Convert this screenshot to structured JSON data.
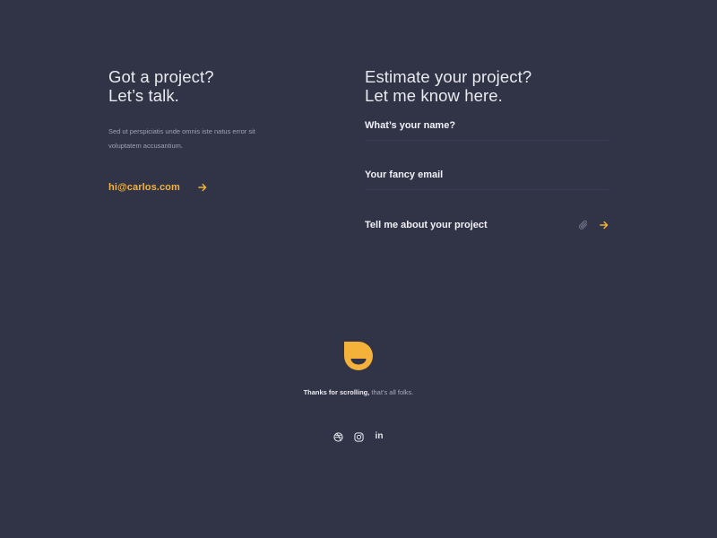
{
  "contact": {
    "heading_line1": "Got a project?",
    "heading_line2": "Let’s talk.",
    "lead": "Sed ut perspiciatis unde omnis iste natus error sit voluptatem accusantium.",
    "email": "hi@carlos.com"
  },
  "form": {
    "title_line1": "Estimate your project?",
    "title_line2": "Let me know here.",
    "name_placeholder": "What’s your name?",
    "email_placeholder": "Your fancy email",
    "project_placeholder": "Tell me about your project"
  },
  "footer": {
    "thanks_bold": "Thanks for scrolling,",
    "thanks_rest": " that’s all folks.",
    "social": {
      "linkedin_glyph": "in"
    }
  },
  "colors": {
    "background": "#313347",
    "accent": "#f4b23a",
    "text": "#f1f1f5",
    "muted": "#9fa1b3"
  },
  "icons": [
    "arrow-right-icon",
    "paperclip-icon",
    "logo-mark",
    "dribbble-icon",
    "instagram-icon",
    "linkedin-icon"
  ]
}
